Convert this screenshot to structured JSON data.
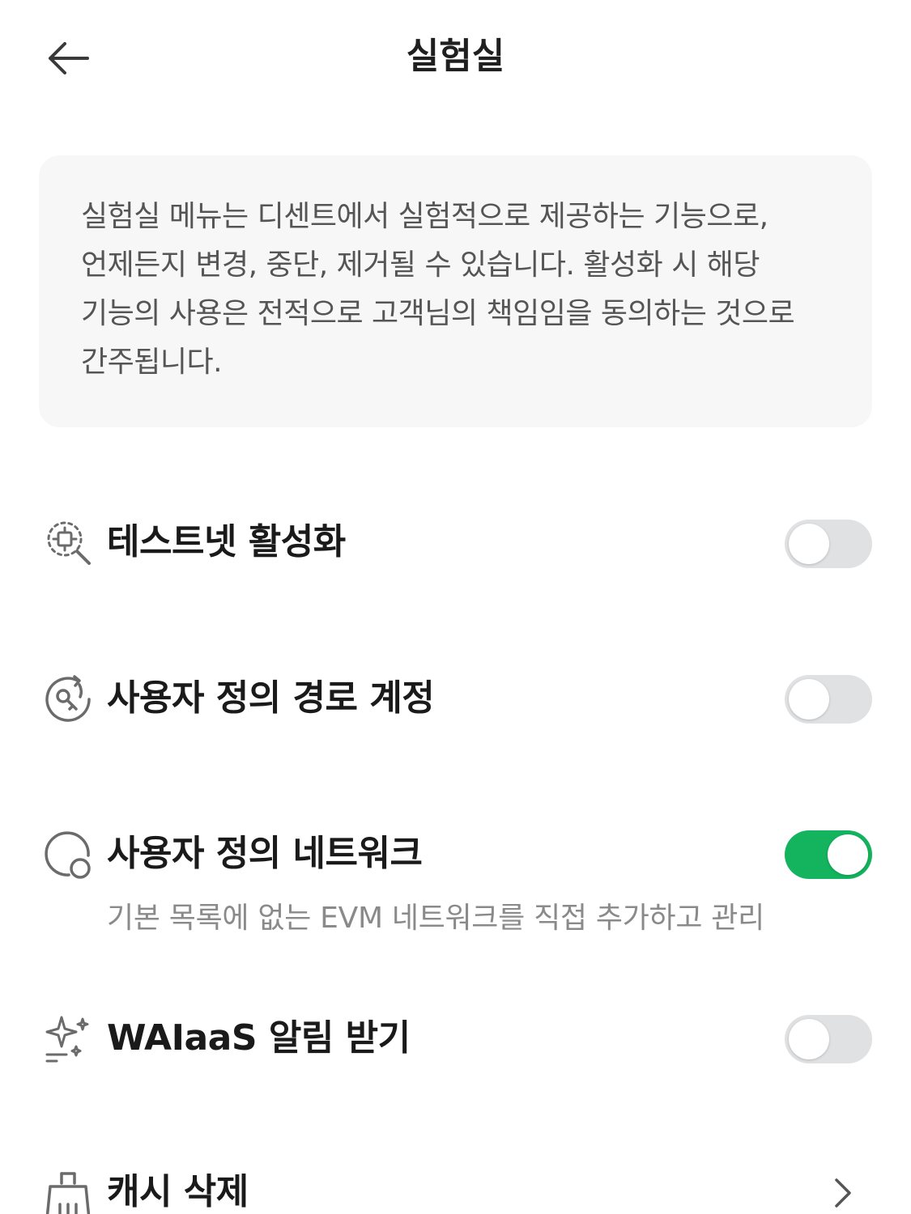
{
  "header": {
    "back_icon": "arrow-left-icon",
    "title": "실험실"
  },
  "notice": {
    "text": "실험실 메뉴는 디센트에서 실험적으로 제공하는 기능으로, 언제든지 변경, 중단, 제거될 수 있습니다. 활성화 시 해당 기능의 사용은 전적으로 고객님의 책임임을 동의하는 것으로 간주됩니다."
  },
  "settings": [
    {
      "label": "테스트넷 활성화",
      "icon": "testnet-search-icon",
      "control": "toggle",
      "enabled": false
    },
    {
      "label": "사용자 정의 경로 계정",
      "icon": "custom-path-key-icon",
      "control": "toggle",
      "enabled": false
    },
    {
      "label": "사용자 정의 네트워크",
      "icon": "custom-network-icon",
      "control": "toggle",
      "enabled": true,
      "description": "기본 목록에 없는 EVM 네트워크를 직접 추가하고 관리"
    },
    {
      "label": "WAIaaS 알림 받기",
      "icon": "sparkle-icon",
      "control": "toggle",
      "enabled": false
    },
    {
      "label": "캐시 삭제",
      "icon": "broom-icon",
      "control": "chevron"
    }
  ],
  "colors": {
    "toggle_on": "#14b35e",
    "toggle_off": "#e0e1e3",
    "notice_bg": "#f7f7f7",
    "icon_gray": "#6b6b6b"
  }
}
